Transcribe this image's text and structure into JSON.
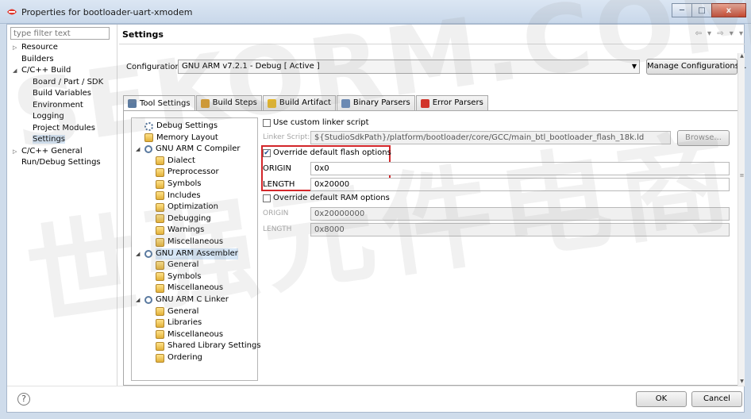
{
  "window": {
    "title": "Properties for bootloader-uart-xmodem",
    "minimize": "─",
    "maximize": "□",
    "close": "x"
  },
  "filter": {
    "placeholder": "type filter text"
  },
  "nav": {
    "items": [
      {
        "label": "Resource",
        "indent": 1,
        "twisty": "▷"
      },
      {
        "label": "Builders",
        "indent": 1,
        "twisty": ""
      },
      {
        "label": "C/C++ Build",
        "indent": 1,
        "twisty": "◢"
      },
      {
        "label": "Board / Part / SDK",
        "indent": 2,
        "twisty": ""
      },
      {
        "label": "Build Variables",
        "indent": 2,
        "twisty": ""
      },
      {
        "label": "Environment",
        "indent": 2,
        "twisty": ""
      },
      {
        "label": "Logging",
        "indent": 2,
        "twisty": ""
      },
      {
        "label": "Project Modules",
        "indent": 2,
        "twisty": ""
      },
      {
        "label": "Settings",
        "indent": 2,
        "twisty": ""
      },
      {
        "label": "C/C++ General",
        "indent": 1,
        "twisty": "▷"
      },
      {
        "label": "Run/Debug Settings",
        "indent": 1,
        "twisty": ""
      }
    ]
  },
  "page": {
    "title": "Settings",
    "nav_arrows": "⇦ ▾ ⇨ ▾ ▾",
    "config_label": "Configuration:",
    "config_value": "GNU ARM v7.2.1 - Debug  [ Active ]",
    "manage_label": "Manage Configurations..."
  },
  "tabs": [
    {
      "label": "Tool Settings",
      "icon_color": "#5a7aa0"
    },
    {
      "label": "Build Steps",
      "icon_color": "#d79a2a"
    },
    {
      "label": "Build Artifact",
      "icon_color": "#e5b526"
    },
    {
      "label": "Binary Parsers",
      "icon_color": "#6c8ab3"
    },
    {
      "label": "Error Parsers",
      "icon_color": "#d1342a"
    }
  ],
  "tool_tree": [
    {
      "label": "Debug Settings",
      "icon": "cog",
      "indent": 1,
      "twisty": ""
    },
    {
      "label": "Memory Layout",
      "icon": "folder",
      "indent": 1,
      "twisty": ""
    },
    {
      "label": "GNU ARM C Compiler",
      "icon": "gear",
      "indent": 1,
      "twisty": "◢"
    },
    {
      "label": "Dialect",
      "icon": "folder",
      "indent": 2,
      "twisty": ""
    },
    {
      "label": "Preprocessor",
      "icon": "folder",
      "indent": 2,
      "twisty": ""
    },
    {
      "label": "Symbols",
      "icon": "folder",
      "indent": 2,
      "twisty": ""
    },
    {
      "label": "Includes",
      "icon": "folder",
      "indent": 2,
      "twisty": ""
    },
    {
      "label": "Optimization",
      "icon": "folder",
      "indent": 2,
      "twisty": ""
    },
    {
      "label": "Debugging",
      "icon": "folder",
      "indent": 2,
      "twisty": ""
    },
    {
      "label": "Warnings",
      "icon": "folder",
      "indent": 2,
      "twisty": ""
    },
    {
      "label": "Miscellaneous",
      "icon": "folder",
      "indent": 2,
      "twisty": ""
    },
    {
      "label": "GNU ARM Assembler",
      "icon": "gear",
      "indent": 1,
      "twisty": "◢"
    },
    {
      "label": "General",
      "icon": "folder",
      "indent": 2,
      "twisty": ""
    },
    {
      "label": "Symbols",
      "icon": "folder",
      "indent": 2,
      "twisty": ""
    },
    {
      "label": "Miscellaneous",
      "icon": "folder",
      "indent": 2,
      "twisty": ""
    },
    {
      "label": "GNU ARM C Linker",
      "icon": "gear",
      "indent": 1,
      "twisty": "◢"
    },
    {
      "label": "General",
      "icon": "folder",
      "indent": 2,
      "twisty": ""
    },
    {
      "label": "Libraries",
      "icon": "folder",
      "indent": 2,
      "twisty": ""
    },
    {
      "label": "Miscellaneous",
      "icon": "folder",
      "indent": 2,
      "twisty": ""
    },
    {
      "label": "Shared Library Settings",
      "icon": "folder",
      "indent": 2,
      "twisty": ""
    },
    {
      "label": "Ordering",
      "icon": "folder",
      "indent": 2,
      "twisty": ""
    }
  ],
  "settings": {
    "custom_script_label": "Use custom linker script",
    "custom_script_checked": false,
    "linker_script_label": "Linker Script:",
    "linker_script_value": "${StudioSdkPath}/platform/bootloader/core/GCC/main_btl_bootloader_flash_18k.ld",
    "browse_label": "Browse...",
    "flash_override_label": "Override default flash options",
    "flash_override_checked": true,
    "flash_origin_label": "ORIGIN",
    "flash_origin_value": "0x0",
    "flash_length_label": "LENGTH",
    "flash_length_value": "0x20000",
    "ram_override_label": "Override default RAM options",
    "ram_override_checked": false,
    "ram_origin_label": "ORIGIN",
    "ram_origin_value": "0x20000000",
    "ram_length_label": "LENGTH",
    "ram_length_value": "0x8000"
  },
  "footer": {
    "help": "?",
    "ok_label": "OK",
    "cancel_label": "Cancel"
  },
  "watermark": {
    "line1": "SEKORM.COM",
    "line2": "世强元件电商"
  },
  "colors": {
    "highlight_box": "#d3262a",
    "selection": "#d6e6f6"
  }
}
